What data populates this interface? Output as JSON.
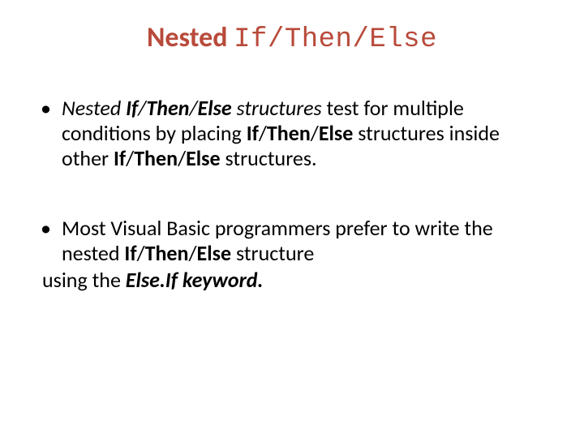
{
  "title": {
    "bold": "Nested ",
    "mono": "If/Then/Else"
  },
  "bullets": {
    "b1": {
      "p1": "Nested ",
      "p2": "If",
      "p3": "/",
      "p4": "Then",
      "p5": "/",
      "p6": "Else",
      "p7": " structures",
      "p8": " test for multiple conditions by placing ",
      "p9": "If",
      "p10": "/",
      "p11": "Then",
      "p12": "/",
      "p13": "Else",
      "p14": " structures inside other ",
      "p15": "If",
      "p16": "/",
      "p17": "Then",
      "p18": "/",
      "p19": "Else",
      "p20": " structures."
    },
    "b2": {
      "p1": "Most Visual Basic programmers prefer to write the nested ",
      "p2": "If",
      "p3": "/",
      "p4": "Then",
      "p5": "/",
      "p6": "Else",
      "p7": " structure",
      "line2a": " using the ",
      "line2b": "Else.If keyword."
    }
  }
}
